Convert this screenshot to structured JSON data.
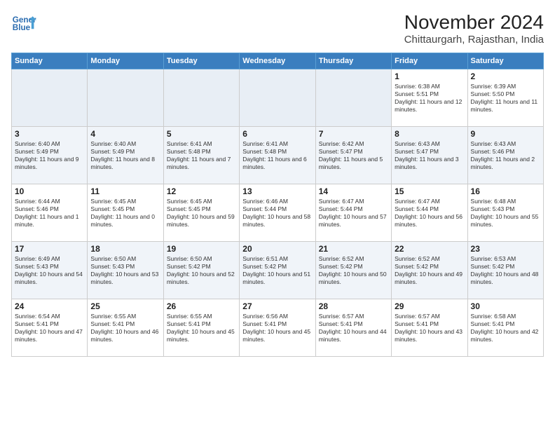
{
  "header": {
    "logo_line1": "General",
    "logo_line2": "Blue",
    "month_title": "November 2024",
    "location": "Chittaurgarh, Rajasthan, India"
  },
  "weekdays": [
    "Sunday",
    "Monday",
    "Tuesday",
    "Wednesday",
    "Thursday",
    "Friday",
    "Saturday"
  ],
  "weeks": [
    [
      {
        "day": "",
        "info": ""
      },
      {
        "day": "",
        "info": ""
      },
      {
        "day": "",
        "info": ""
      },
      {
        "day": "",
        "info": ""
      },
      {
        "day": "",
        "info": ""
      },
      {
        "day": "1",
        "info": "Sunrise: 6:38 AM\nSunset: 5:51 PM\nDaylight: 11 hours and 12 minutes."
      },
      {
        "day": "2",
        "info": "Sunrise: 6:39 AM\nSunset: 5:50 PM\nDaylight: 11 hours and 11 minutes."
      }
    ],
    [
      {
        "day": "3",
        "info": "Sunrise: 6:40 AM\nSunset: 5:49 PM\nDaylight: 11 hours and 9 minutes."
      },
      {
        "day": "4",
        "info": "Sunrise: 6:40 AM\nSunset: 5:49 PM\nDaylight: 11 hours and 8 minutes."
      },
      {
        "day": "5",
        "info": "Sunrise: 6:41 AM\nSunset: 5:48 PM\nDaylight: 11 hours and 7 minutes."
      },
      {
        "day": "6",
        "info": "Sunrise: 6:41 AM\nSunset: 5:48 PM\nDaylight: 11 hours and 6 minutes."
      },
      {
        "day": "7",
        "info": "Sunrise: 6:42 AM\nSunset: 5:47 PM\nDaylight: 11 hours and 5 minutes."
      },
      {
        "day": "8",
        "info": "Sunrise: 6:43 AM\nSunset: 5:47 PM\nDaylight: 11 hours and 3 minutes."
      },
      {
        "day": "9",
        "info": "Sunrise: 6:43 AM\nSunset: 5:46 PM\nDaylight: 11 hours and 2 minutes."
      }
    ],
    [
      {
        "day": "10",
        "info": "Sunrise: 6:44 AM\nSunset: 5:46 PM\nDaylight: 11 hours and 1 minute."
      },
      {
        "day": "11",
        "info": "Sunrise: 6:45 AM\nSunset: 5:45 PM\nDaylight: 11 hours and 0 minutes."
      },
      {
        "day": "12",
        "info": "Sunrise: 6:45 AM\nSunset: 5:45 PM\nDaylight: 10 hours and 59 minutes."
      },
      {
        "day": "13",
        "info": "Sunrise: 6:46 AM\nSunset: 5:44 PM\nDaylight: 10 hours and 58 minutes."
      },
      {
        "day": "14",
        "info": "Sunrise: 6:47 AM\nSunset: 5:44 PM\nDaylight: 10 hours and 57 minutes."
      },
      {
        "day": "15",
        "info": "Sunrise: 6:47 AM\nSunset: 5:44 PM\nDaylight: 10 hours and 56 minutes."
      },
      {
        "day": "16",
        "info": "Sunrise: 6:48 AM\nSunset: 5:43 PM\nDaylight: 10 hours and 55 minutes."
      }
    ],
    [
      {
        "day": "17",
        "info": "Sunrise: 6:49 AM\nSunset: 5:43 PM\nDaylight: 10 hours and 54 minutes."
      },
      {
        "day": "18",
        "info": "Sunrise: 6:50 AM\nSunset: 5:43 PM\nDaylight: 10 hours and 53 minutes."
      },
      {
        "day": "19",
        "info": "Sunrise: 6:50 AM\nSunset: 5:42 PM\nDaylight: 10 hours and 52 minutes."
      },
      {
        "day": "20",
        "info": "Sunrise: 6:51 AM\nSunset: 5:42 PM\nDaylight: 10 hours and 51 minutes."
      },
      {
        "day": "21",
        "info": "Sunrise: 6:52 AM\nSunset: 5:42 PM\nDaylight: 10 hours and 50 minutes."
      },
      {
        "day": "22",
        "info": "Sunrise: 6:52 AM\nSunset: 5:42 PM\nDaylight: 10 hours and 49 minutes."
      },
      {
        "day": "23",
        "info": "Sunrise: 6:53 AM\nSunset: 5:42 PM\nDaylight: 10 hours and 48 minutes."
      }
    ],
    [
      {
        "day": "24",
        "info": "Sunrise: 6:54 AM\nSunset: 5:41 PM\nDaylight: 10 hours and 47 minutes."
      },
      {
        "day": "25",
        "info": "Sunrise: 6:55 AM\nSunset: 5:41 PM\nDaylight: 10 hours and 46 minutes."
      },
      {
        "day": "26",
        "info": "Sunrise: 6:55 AM\nSunset: 5:41 PM\nDaylight: 10 hours and 45 minutes."
      },
      {
        "day": "27",
        "info": "Sunrise: 6:56 AM\nSunset: 5:41 PM\nDaylight: 10 hours and 45 minutes."
      },
      {
        "day": "28",
        "info": "Sunrise: 6:57 AM\nSunset: 5:41 PM\nDaylight: 10 hours and 44 minutes."
      },
      {
        "day": "29",
        "info": "Sunrise: 6:57 AM\nSunset: 5:41 PM\nDaylight: 10 hours and 43 minutes."
      },
      {
        "day": "30",
        "info": "Sunrise: 6:58 AM\nSunset: 5:41 PM\nDaylight: 10 hours and 42 minutes."
      }
    ]
  ]
}
